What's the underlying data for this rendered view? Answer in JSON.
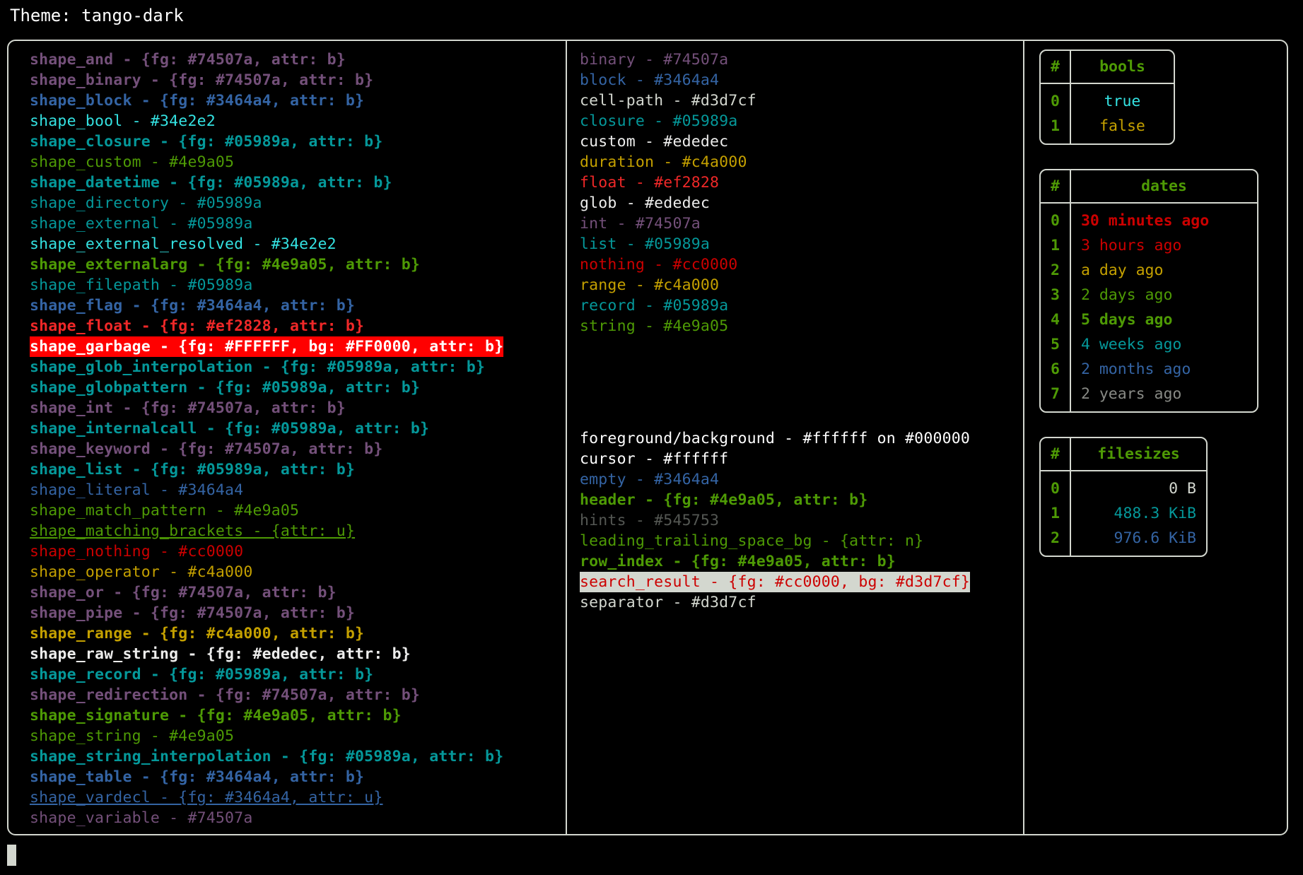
{
  "header": {
    "label": "Theme: tango-dark"
  },
  "colors": {
    "purple": "#74507a",
    "blue": "#3464a4",
    "cyan_bright": "#34e2e2",
    "teal": "#05989a",
    "green": "#4e9a05",
    "red_bright": "#ef2828",
    "red": "#cc0000",
    "yellow": "#c4a000",
    "white": "#ededec",
    "light_gray": "#d3d7cf",
    "dark_gray": "#545753",
    "garbage_fg": "#FFFFFF",
    "garbage_bg": "#FF0000",
    "search_result_fg": "#cc0000",
    "search_result_bg": "#d3d7cf",
    "border": "#d3d7cf"
  },
  "shapes": [
    {
      "text": "shape_and - {fg: #74507a, attr: b}",
      "fg": "#74507a",
      "bold": true
    },
    {
      "text": "shape_binary - {fg: #74507a, attr: b}",
      "fg": "#74507a",
      "bold": true
    },
    {
      "text": "shape_block - {fg: #3464a4, attr: b}",
      "fg": "#3464a4",
      "bold": true
    },
    {
      "text": "shape_bool - #34e2e2",
      "fg": "#34e2e2",
      "bold": false
    },
    {
      "text": "shape_closure - {fg: #05989a, attr: b}",
      "fg": "#05989a",
      "bold": true
    },
    {
      "text": "shape_custom - #4e9a05",
      "fg": "#4e9a05",
      "bold": false
    },
    {
      "text": "shape_datetime - {fg: #05989a, attr: b}",
      "fg": "#05989a",
      "bold": true
    },
    {
      "text": "shape_directory - #05989a",
      "fg": "#05989a",
      "bold": false
    },
    {
      "text": "shape_external - #05989a",
      "fg": "#05989a",
      "bold": false
    },
    {
      "text": "shape_external_resolved - #34e2e2",
      "fg": "#34e2e2",
      "bold": false
    },
    {
      "text": "shape_externalarg - {fg: #4e9a05, attr: b}",
      "fg": "#4e9a05",
      "bold": true
    },
    {
      "text": "shape_filepath - #05989a",
      "fg": "#05989a",
      "bold": false
    },
    {
      "text": "shape_flag - {fg: #3464a4, attr: b}",
      "fg": "#3464a4",
      "bold": true
    },
    {
      "text": "shape_float - {fg: #ef2828, attr: b}",
      "fg": "#ef2828",
      "bold": true
    },
    {
      "text": "shape_garbage - {fg: #FFFFFF, bg: #FF0000, attr: b}",
      "fg": "#FFFFFF",
      "bg": "#FF0000",
      "bold": true
    },
    {
      "text": "shape_glob_interpolation - {fg: #05989a, attr: b}",
      "fg": "#05989a",
      "bold": true
    },
    {
      "text": "shape_globpattern - {fg: #05989a, attr: b}",
      "fg": "#05989a",
      "bold": true
    },
    {
      "text": "shape_int - {fg: #74507a, attr: b}",
      "fg": "#74507a",
      "bold": true
    },
    {
      "text": "shape_internalcall - {fg: #05989a, attr: b}",
      "fg": "#05989a",
      "bold": true
    },
    {
      "text": "shape_keyword - {fg: #74507a, attr: b}",
      "fg": "#74507a",
      "bold": true
    },
    {
      "text": "shape_list - {fg: #05989a, attr: b}",
      "fg": "#05989a",
      "bold": true
    },
    {
      "text": "shape_literal - #3464a4",
      "fg": "#3464a4",
      "bold": false
    },
    {
      "text": "shape_match_pattern - #4e9a05",
      "fg": "#4e9a05",
      "bold": false
    },
    {
      "text": "shape_matching_brackets - {attr: u}",
      "fg": "#4e9a05",
      "bold": false,
      "underline": true
    },
    {
      "text": "shape_nothing - #cc0000",
      "fg": "#cc0000",
      "bold": false
    },
    {
      "text": "shape_operator - #c4a000",
      "fg": "#c4a000",
      "bold": false
    },
    {
      "text": "shape_or - {fg: #74507a, attr: b}",
      "fg": "#74507a",
      "bold": true
    },
    {
      "text": "shape_pipe - {fg: #74507a, attr: b}",
      "fg": "#74507a",
      "bold": true
    },
    {
      "text": "shape_range - {fg: #c4a000, attr: b}",
      "fg": "#c4a000",
      "bold": true
    },
    {
      "text": "shape_raw_string - {fg: #ededec, attr: b}",
      "fg": "#ededec",
      "bold": true
    },
    {
      "text": "shape_record - {fg: #05989a, attr: b}",
      "fg": "#05989a",
      "bold": true
    },
    {
      "text": "shape_redirection - {fg: #74507a, attr: b}",
      "fg": "#74507a",
      "bold": true
    },
    {
      "text": "shape_signature - {fg: #4e9a05, attr: b}",
      "fg": "#4e9a05",
      "bold": true
    },
    {
      "text": "shape_string - #4e9a05",
      "fg": "#4e9a05",
      "bold": false
    },
    {
      "text": "shape_string_interpolation - {fg: #05989a, attr: b}",
      "fg": "#05989a",
      "bold": true
    },
    {
      "text": "shape_table - {fg: #3464a4, attr: b}",
      "fg": "#3464a4",
      "bold": true
    },
    {
      "text": "shape_vardecl - {fg: #3464a4, attr: u}",
      "fg": "#3464a4",
      "bold": false,
      "underline": true
    },
    {
      "text": "shape_variable - #74507a",
      "fg": "#74507a",
      "bold": false
    }
  ],
  "types": [
    {
      "text": "binary - #74507a",
      "fg": "#74507a",
      "bold": false
    },
    {
      "text": "block - #3464a4",
      "fg": "#3464a4",
      "bold": false
    },
    {
      "text": "cell-path - #d3d7cf",
      "fg": "#d3d7cf",
      "bold": false
    },
    {
      "text": "closure - #05989a",
      "fg": "#05989a",
      "bold": false
    },
    {
      "text": "custom - #ededec",
      "fg": "#ededec",
      "bold": false
    },
    {
      "text": "duration - #c4a000",
      "fg": "#c4a000",
      "bold": false
    },
    {
      "text": "float - #ef2828",
      "fg": "#ef2828",
      "bold": false
    },
    {
      "text": "glob - #ededec",
      "fg": "#ededec",
      "bold": false
    },
    {
      "text": "int - #74507a",
      "fg": "#74507a",
      "bold": false
    },
    {
      "text": "list - #05989a",
      "fg": "#05989a",
      "bold": false
    },
    {
      "text": "nothing - #cc0000",
      "fg": "#cc0000",
      "bold": false
    },
    {
      "text": "range - #c4a000",
      "fg": "#c4a000",
      "bold": false
    },
    {
      "text": "record - #05989a",
      "fg": "#05989a",
      "bold": false
    },
    {
      "text": "string - #4e9a05",
      "fg": "#4e9a05",
      "bold": false
    }
  ],
  "ui_elements": [
    {
      "text": "foreground/background - #ffffff on #000000",
      "fg": "#ffffff",
      "bold": false
    },
    {
      "text": "cursor - #ffffff",
      "fg": "#ffffff",
      "bold": false
    },
    {
      "text": "empty - #3464a4",
      "fg": "#3464a4",
      "bold": false
    },
    {
      "text": "header - {fg: #4e9a05, attr: b}",
      "fg": "#4e9a05",
      "bold": true
    },
    {
      "text": "hints - #545753",
      "fg": "#545753",
      "bold": false
    },
    {
      "text": "leading_trailing_space_bg - {attr: n}",
      "fg": "#4e9a05",
      "bold": false
    },
    {
      "text": "row_index - {fg: #4e9a05, attr: b}",
      "fg": "#4e9a05",
      "bold": true
    },
    {
      "text": "search_result - {fg: #cc0000, bg: #d3d7cf}",
      "fg": "#cc0000",
      "bg": "#d3d7cf",
      "bold": false
    },
    {
      "text": "separator - #d3d7cf",
      "fg": "#d3d7cf",
      "bold": false
    }
  ],
  "tables": [
    {
      "name": "bools",
      "index_header": "#",
      "value_header": "bools",
      "align": "center",
      "rows": [
        {
          "index": "0",
          "value": "true",
          "fg": "#34e2e2",
          "bold": false
        },
        {
          "index": "1",
          "value": "false",
          "fg": "#c4a000",
          "bold": false
        }
      ]
    },
    {
      "name": "dates",
      "index_header": "#",
      "value_header": "dates",
      "align": "left",
      "rows": [
        {
          "index": "0",
          "value": "30 minutes ago",
          "fg": "#cc0000",
          "bold": true
        },
        {
          "index": "1",
          "value": "3 hours ago",
          "fg": "#cc0000",
          "bold": false
        },
        {
          "index": "2",
          "value": "a day ago",
          "fg": "#c4a000",
          "bold": false
        },
        {
          "index": "3",
          "value": "2 days ago",
          "fg": "#4e9a05",
          "bold": false
        },
        {
          "index": "4",
          "value": "5 days ago",
          "fg": "#4e9a05",
          "bold": true
        },
        {
          "index": "5",
          "value": "4 weeks ago",
          "fg": "#05989a",
          "bold": false
        },
        {
          "index": "6",
          "value": "2 months ago",
          "fg": "#3464a4",
          "bold": false
        },
        {
          "index": "7",
          "value": "2 years ago",
          "fg": "#888a85",
          "bold": false
        }
      ]
    },
    {
      "name": "filesizes",
      "index_header": "#",
      "value_header": "filesizes",
      "align": "right",
      "rows": [
        {
          "index": "0",
          "value": "0 B",
          "fg": "#d3d7cf",
          "bold": false
        },
        {
          "index": "1",
          "value": "488.3 KiB",
          "fg": "#05989a",
          "bold": false
        },
        {
          "index": "2",
          "value": "976.6 KiB",
          "fg": "#3464a4",
          "bold": false
        }
      ]
    }
  ]
}
